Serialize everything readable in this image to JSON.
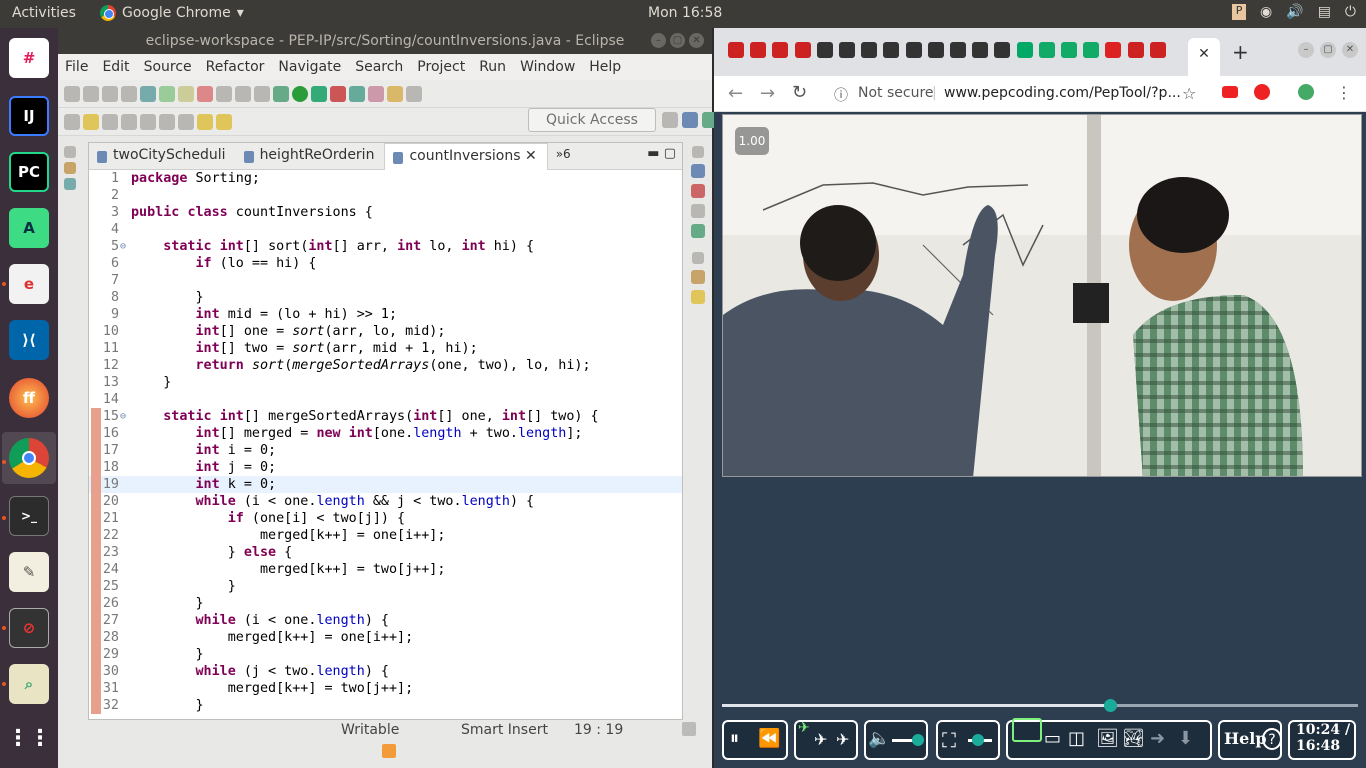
{
  "topbar": {
    "activities": "Activities",
    "app": "Google Chrome",
    "clock": "Mon 16:58"
  },
  "eclipse": {
    "title": "eclipse-workspace - PEP-IP/src/Sorting/countInversions.java - Eclipse",
    "menu": [
      "File",
      "Edit",
      "Source",
      "Refactor",
      "Navigate",
      "Search",
      "Project",
      "Run",
      "Window",
      "Help"
    ],
    "quick_access": "Quick Access",
    "tabs": [
      "twoCitySchedulі",
      "heightReOrderin",
      "countInversions",
      "»6"
    ],
    "status": {
      "writable": "Writable",
      "insert": "Smart Insert",
      "pos": "19 : 19"
    }
  },
  "code": [
    {
      "n": "1",
      "t": "package Sorting;"
    },
    {
      "n": "2",
      "t": ""
    },
    {
      "n": "3",
      "t": "public class countInversions {"
    },
    {
      "n": "4",
      "t": ""
    },
    {
      "n": "5",
      "t": "    static int[] sort(int[] arr, int lo, int hi) {"
    },
    {
      "n": "6",
      "t": "        if (lo == hi) {"
    },
    {
      "n": "7",
      "t": ""
    },
    {
      "n": "8",
      "t": "        }"
    },
    {
      "n": "9",
      "t": "        int mid = (lo + hi) >> 1;"
    },
    {
      "n": "10",
      "t": "        int[] one = sort(arr, lo, mid);"
    },
    {
      "n": "11",
      "t": "        int[] two = sort(arr, mid + 1, hi);"
    },
    {
      "n": "12",
      "t": "        return sort(mergeSortedArrays(one, two), lo, hi);"
    },
    {
      "n": "13",
      "t": "    }"
    },
    {
      "n": "14",
      "t": ""
    },
    {
      "n": "15",
      "t": "    static int[] mergeSortedArrays(int[] one, int[] two) {"
    },
    {
      "n": "16",
      "t": "        int[] merged = new int[one.length + two.length];"
    },
    {
      "n": "17",
      "t": "        int i = 0;"
    },
    {
      "n": "18",
      "t": "        int j = 0;"
    },
    {
      "n": "19",
      "t": "        int k = 0;"
    },
    {
      "n": "20",
      "t": "        while (i < one.length && j < two.length) {"
    },
    {
      "n": "21",
      "t": "            if (one[i] < two[j]) {"
    },
    {
      "n": "22",
      "t": "                merged[k++] = one[i++];"
    },
    {
      "n": "23",
      "t": "            } else {"
    },
    {
      "n": "24",
      "t": "                merged[k++] = two[j++];"
    },
    {
      "n": "25",
      "t": "            }"
    },
    {
      "n": "26",
      "t": "        }"
    },
    {
      "n": "27",
      "t": "        while (i < one.length) {"
    },
    {
      "n": "28",
      "t": "            merged[k++] = one[i++];"
    },
    {
      "n": "29",
      "t": "        }"
    },
    {
      "n": "30",
      "t": "        while (j < two.length) {"
    },
    {
      "n": "31",
      "t": "            merged[k++] = two[j++];"
    },
    {
      "n": "32",
      "t": "        }"
    }
  ],
  "chrome": {
    "url_prefix": "Not secure",
    "url": "www.pepcoding.com/PepTool/?p...",
    "speed": "1.00",
    "help": "Help",
    "time_current": "10:24 /",
    "time_total": "16:48",
    "progress": 0.61,
    "volume": 0.85
  },
  "colors": {
    "dock": "#3a2f3a",
    "player_bg": "#2d3e50",
    "accent": "#1aab9b"
  }
}
